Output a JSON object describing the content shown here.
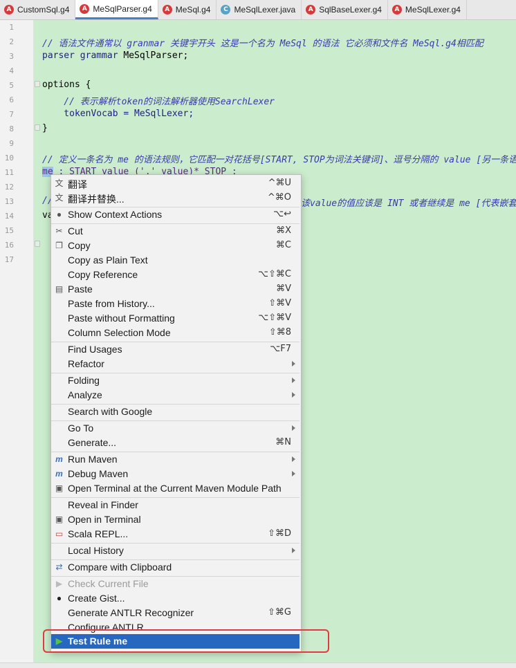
{
  "tabs": [
    {
      "label": "CustomSql.g4",
      "icon": "antlr-icon",
      "active": false
    },
    {
      "label": "MeSqlParser.g4",
      "icon": "antlr-icon",
      "active": true
    },
    {
      "label": "MeSql.g4",
      "icon": "antlr-icon",
      "active": false
    },
    {
      "label": "MeSqlLexer.java",
      "icon": "java-class-icon",
      "active": false
    },
    {
      "label": "SqlBaseLexer.g4",
      "icon": "antlr-icon",
      "active": false
    },
    {
      "label": "MeSqlLexer.g4",
      "icon": "antlr-icon",
      "active": false
    }
  ],
  "editor": {
    "line_numbers": [
      "1",
      "2",
      "3",
      "4",
      "5",
      "6",
      "7",
      "8",
      "9",
      "10",
      "11",
      "12",
      "13",
      "14",
      "15",
      "16",
      "17"
    ],
    "lines": {
      "l2": "// 语法文件通常以 granmar 关键宇开头 这是一个名为 MeSql 的语法 它必须和文件名 MeSql.g4相匹配",
      "l3_kw": "parser grammar",
      "l3_name": " MeSqlParser;",
      "l5": "options {",
      "l6": "    // 表示解析token的词法解析器使用SearchLexer",
      "l7": "    tokenVocab = MeSqlLexer;",
      "l8": "}",
      "l10": "// 定义一条名为 me 的语法规则，它匹配一对花括号[START, STOP为词法关键词]、逗号分隔的 value [另一条语",
      "l11_sel": "me",
      "l11_rest": " : START value (',' value)* STOP ;",
      "l13_a": "//",
      "l13_b": "该value的值应该是 INT 或者继续是 me [代表嵌套]",
      "l14": "va"
    }
  },
  "context_menu": {
    "items": {
      "translate": {
        "label": "翻译",
        "shortcut": "^⌘U"
      },
      "translate_replace": {
        "label": "翻译并替换...",
        "shortcut": "^⌘O"
      },
      "show_context_actions": {
        "label": "Show Context Actions",
        "shortcut": "⌥↩"
      },
      "cut": {
        "label": "Cut",
        "shortcut": "⌘X"
      },
      "copy": {
        "label": "Copy",
        "shortcut": "⌘C"
      },
      "copy_plain": {
        "label": "Copy as Plain Text",
        "shortcut": ""
      },
      "copy_reference": {
        "label": "Copy Reference",
        "shortcut": "⌥⇧⌘C"
      },
      "paste": {
        "label": "Paste",
        "shortcut": "⌘V"
      },
      "paste_history": {
        "label": "Paste from History...",
        "shortcut": "⇧⌘V"
      },
      "paste_no_format": {
        "label": "Paste without Formatting",
        "shortcut": "⌥⇧⌘V"
      },
      "column_mode": {
        "label": "Column Selection Mode",
        "shortcut": "⇧⌘8"
      },
      "find_usages": {
        "label": "Find Usages",
        "shortcut": "⌥F7"
      },
      "refactor": {
        "label": "Refactor"
      },
      "folding": {
        "label": "Folding"
      },
      "analyze": {
        "label": "Analyze"
      },
      "search_google": {
        "label": "Search with Google"
      },
      "go_to": {
        "label": "Go To"
      },
      "generate": {
        "label": "Generate...",
        "shortcut": "⌘N"
      },
      "run_maven": {
        "label": "Run Maven"
      },
      "debug_maven": {
        "label": "Debug Maven"
      },
      "open_terminal_maven": {
        "label": "Open Terminal at the Current Maven Module Path"
      },
      "reveal_finder": {
        "label": "Reveal in Finder"
      },
      "open_terminal": {
        "label": "Open in Terminal"
      },
      "scala_repl": {
        "label": "Scala REPL...",
        "shortcut": "⇧⌘D"
      },
      "local_history": {
        "label": "Local History"
      },
      "compare_clipboard": {
        "label": "Compare with Clipboard"
      },
      "check_file": {
        "label": "Check Current File"
      },
      "create_gist": {
        "label": "Create Gist..."
      },
      "generate_antlr": {
        "label": "Generate ANTLR Recognizer",
        "shortcut": "⇧⌘G"
      },
      "configure_antlr": {
        "label": "Configure ANTLR..."
      },
      "test_rule": {
        "label": "Test Rule me"
      }
    }
  },
  "colors": {
    "editor_bg": "#cbeccd",
    "selected_item": "#2667c0",
    "callout_border": "#e03a3a",
    "comment": "#3a3aad"
  }
}
